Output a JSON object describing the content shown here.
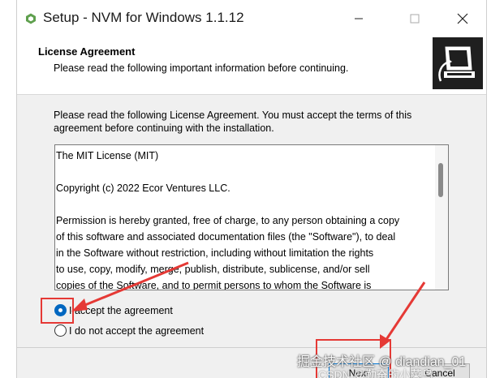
{
  "window": {
    "title": "Setup - NVM for Windows 1.1.12",
    "minimize_icon": "minimize-icon",
    "maximize_icon": "maximize-icon",
    "close_icon": "close-icon"
  },
  "header": {
    "title": "License Agreement",
    "subtitle": "Please read the following important information before continuing."
  },
  "intro": {
    "line1": "Please read the following License Agreement. You must accept the terms of this",
    "line2": "agreement before continuing with the installation."
  },
  "license": {
    "lines": [
      "The MIT License (MIT)",
      "",
      "Copyright (c) 2022 Ecor Ventures LLC.",
      "",
      "Permission is hereby granted, free of charge, to any person obtaining a copy",
      "of this software and associated documentation files (the \"Software\"), to deal",
      "in the Software without restriction, including without limitation the rights",
      "to use, copy, modify, merge, publish, distribute, sublicense, and/or sell",
      "copies of the Software, and to permit persons to whom the Software is"
    ]
  },
  "options": {
    "accept_label": "I accept the agreement",
    "decline_label": "I do not accept the agreement",
    "selected": "accept"
  },
  "buttons": {
    "next_label": "Next",
    "cancel_label": "Cancel"
  },
  "watermark": {
    "line1": "掘金技术社区 @ diandian_01",
    "line2": "CSDN @勤奋的小菜鸟"
  },
  "colors": {
    "accent": "#0067c0",
    "highlight": "#e53935",
    "dialog_bg": "#f0f0f0"
  }
}
